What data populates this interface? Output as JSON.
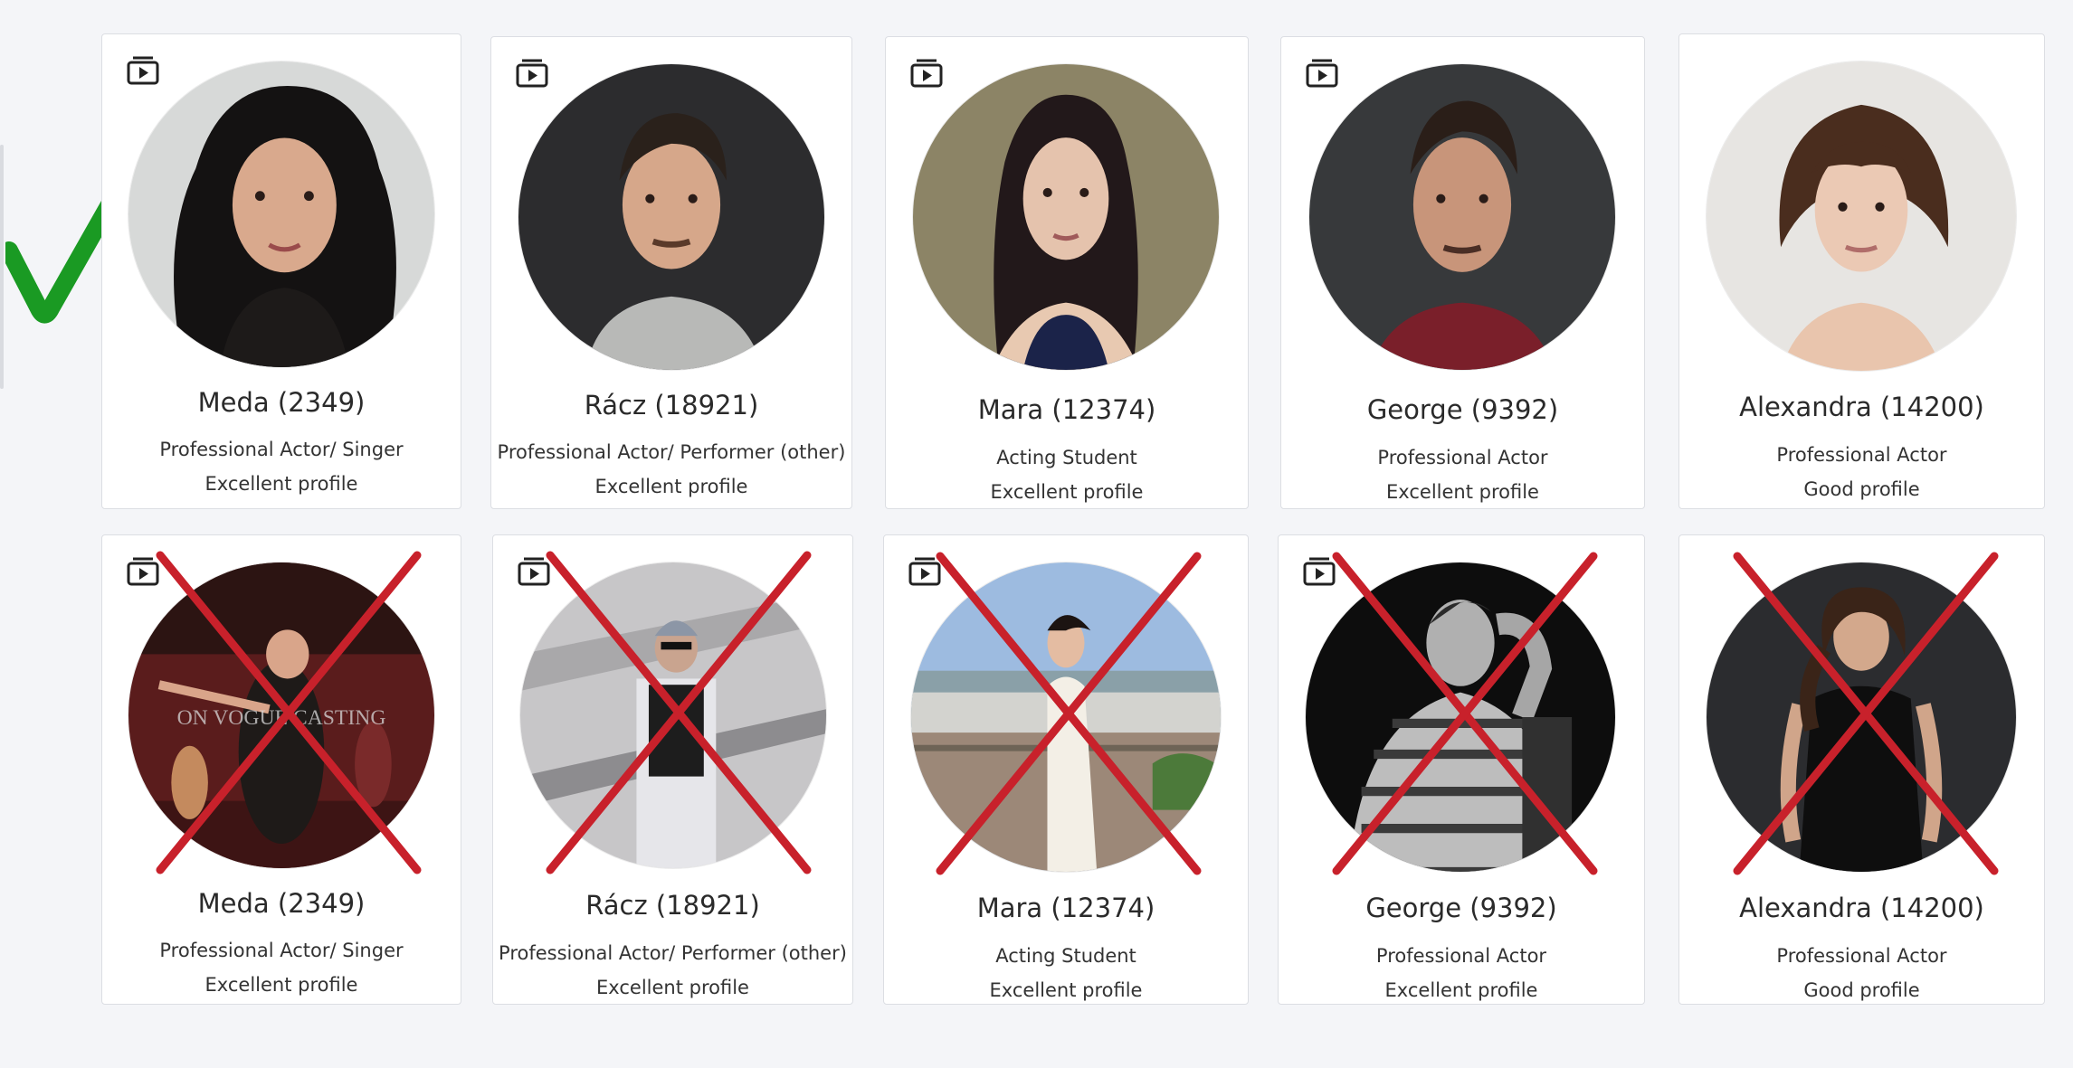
{
  "rows": [
    {
      "status": "approved",
      "cards": [
        {
          "name": "Meda (2349)",
          "role": "Professional Actor/ Singer",
          "quality": "Excellent profile",
          "has_video": true,
          "photo": "headshot-dark-curly-hair"
        },
        {
          "name": "Rácz (18921)",
          "role": "Professional Actor/ Performer (other)",
          "quality": "Excellent profile",
          "has_video": true,
          "photo": "headshot-grey-shirt"
        },
        {
          "name": "Mara (12374)",
          "role": "Acting Student",
          "quality": "Excellent profile",
          "has_video": true,
          "photo": "headshot-navy-halter"
        },
        {
          "name": "George (9392)",
          "role": "Professional Actor",
          "quality": "Excellent profile",
          "has_video": true,
          "photo": "headshot-red-shirt"
        },
        {
          "name": "Alexandra (14200)",
          "role": "Professional Actor",
          "quality": "Good profile",
          "has_video": false,
          "photo": "headshot-bob-haircut"
        }
      ]
    },
    {
      "status": "rejected",
      "cards": [
        {
          "name": "Meda (2349)",
          "role": "Professional Actor/ Singer",
          "quality": "Excellent profile",
          "has_video": true,
          "photo": "stage-performance",
          "watermark": "ON VOGUE CASTING"
        },
        {
          "name": "Rácz (18921)",
          "role": "Professional Actor/ Performer (other)",
          "quality": "Excellent profile",
          "has_video": true,
          "photo": "fashion-runway"
        },
        {
          "name": "Mara (12374)",
          "role": "Acting Student",
          "quality": "Excellent profile",
          "has_video": true,
          "photo": "balcony-white-dress"
        },
        {
          "name": "George (9392)",
          "role": "Professional Actor",
          "quality": "Excellent profile",
          "has_video": true,
          "photo": "black-white-striped-shirt"
        },
        {
          "name": "Alexandra (14200)",
          "role": "Professional Actor",
          "quality": "Good profile",
          "has_video": false,
          "photo": "dark-background-portrait"
        }
      ]
    }
  ],
  "colors": {
    "approved": "#1a9a23",
    "rejected": "#c8212b",
    "page_bg": "#f4f5f8",
    "card_bg": "#ffffff"
  },
  "icons": {
    "approved": "check-mark-icon",
    "rejected": "cross-mark-icon",
    "video": "video-reel-icon"
  }
}
